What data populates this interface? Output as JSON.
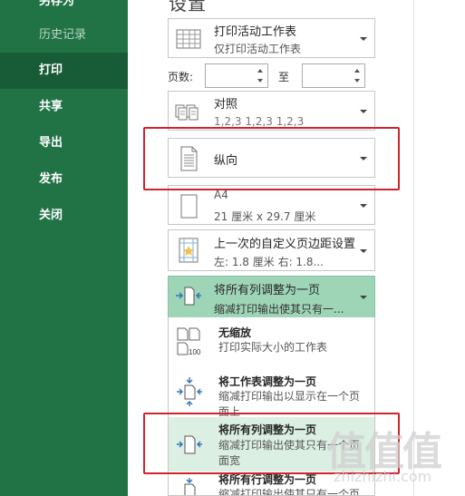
{
  "sidebar": {
    "items": [
      {
        "label": "另存为"
      },
      {
        "label": "历史记录"
      },
      {
        "label": "打印"
      },
      {
        "label": "共享"
      },
      {
        "label": "导出"
      },
      {
        "label": "发布"
      },
      {
        "label": "关闭"
      }
    ]
  },
  "settings": {
    "heading": "设置",
    "print_what": {
      "title": "打印活动工作表",
      "subtitle": "仅打印活动工作表"
    },
    "pages": {
      "label": "页数:",
      "to_label": "至",
      "from_value": "",
      "to_value": ""
    },
    "collate": {
      "title": "对照",
      "subtitle": "1,2,3    1,2,3    1,2,3"
    },
    "orientation": {
      "title": "纵向"
    },
    "paper": {
      "title": "A4",
      "subtitle": "21 厘米 x 29.7 厘米"
    },
    "margins": {
      "title": "上一次的自定义页边距设置",
      "subtitle": "左: 1.8 厘米    右: 1.8..."
    },
    "scaling": {
      "title": "将所有列调整为一页",
      "subtitle": "缩减打印输出使其只有一..."
    }
  },
  "scaling_options": [
    {
      "title": "无缩放",
      "desc": "打印实际大小的工作表"
    },
    {
      "title": "将工作表调整为一页",
      "desc": "缩减打印输出以显示在一个页面上"
    },
    {
      "title": "将所有列调整为一页",
      "desc": "缩减打印输出使其只有一个页面宽"
    },
    {
      "title": "将所有行调整为一页",
      "desc": "缩减打印输出使其只有一个页面高"
    }
  ],
  "watermark": {
    "text": "值值值",
    "sub": "zhizhizhi.com"
  },
  "colors": {
    "sidebar": "#217346",
    "sidebar_active": "#185c37",
    "selected": "#9fd5b7",
    "annotation": "#d0242b"
  }
}
